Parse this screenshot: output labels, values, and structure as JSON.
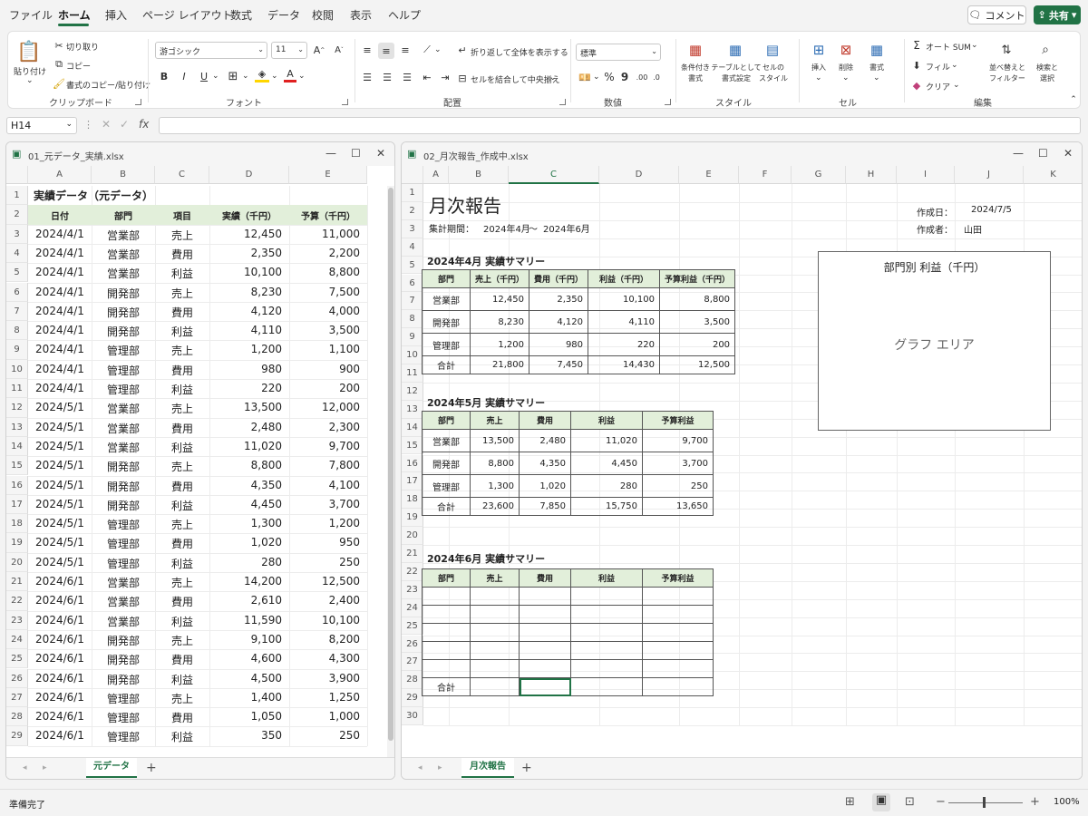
{
  "menu": [
    "ファイル",
    "ホーム",
    "挿入",
    "ページ レイアウト",
    "数式",
    "データ",
    "校閲",
    "表示",
    "ヘルプ"
  ],
  "comment_label": "コメント",
  "share_label": "共有",
  "ribbon": {
    "paste": "貼り付け",
    "cut": "切り取り",
    "copy": "コピー",
    "format_painter": "書式のコピー/貼り付け",
    "clipboard": "クリップボード",
    "font_name": "游ゴシック",
    "font_size": "11",
    "bold": "B",
    "italic": "I",
    "underline": "U",
    "font_group": "フォント",
    "wrap": "折り返して全体を表示する",
    "merge": "セルを結合して中央揃え",
    "align_group": "配置",
    "number_format": "標準",
    "percent": "%",
    "comma": "9",
    "number_group": "数値",
    "cond_format": "条件付き\n書式",
    "table_format": "テーブルとして\n書式設定",
    "cell_style": "セルの\nスタイル",
    "style_group": "スタイル",
    "insert": "挿入",
    "delete": "削除",
    "format": "書式",
    "cells_group": "セル",
    "autosum": "オート SUM",
    "fill": "フィル",
    "clear": "クリア",
    "sort": "並べ替えと\nフィルター",
    "find": "検索と\n選択",
    "edit_group": "編集"
  },
  "namebox": "H14",
  "left": {
    "title": "01_元データ_実績.xlsx",
    "cols": [
      "A",
      "B",
      "C",
      "D",
      "E"
    ],
    "header_row": [
      "日付",
      "部門",
      "項目",
      "実績（千円）",
      "予算（千円）"
    ],
    "a1": "実績データ（元データ）",
    "rows": [
      [
        "2024/4/1",
        "営業部",
        "売上",
        "12,450",
        "11,000"
      ],
      [
        "2024/4/1",
        "営業部",
        "費用",
        "2,350",
        "2,200"
      ],
      [
        "2024/4/1",
        "営業部",
        "利益",
        "10,100",
        "8,800"
      ],
      [
        "2024/4/1",
        "開発部",
        "売上",
        "8,230",
        "7,500"
      ],
      [
        "2024/4/1",
        "開発部",
        "費用",
        "4,120",
        "4,000"
      ],
      [
        "2024/4/1",
        "開発部",
        "利益",
        "4,110",
        "3,500"
      ],
      [
        "2024/4/1",
        "管理部",
        "売上",
        "1,200",
        "1,100"
      ],
      [
        "2024/4/1",
        "管理部",
        "費用",
        "980",
        "900"
      ],
      [
        "2024/4/1",
        "管理部",
        "利益",
        "220",
        "200"
      ],
      [
        "2024/5/1",
        "営業部",
        "売上",
        "13,500",
        "12,000"
      ],
      [
        "2024/5/1",
        "営業部",
        "費用",
        "2,480",
        "2,300"
      ],
      [
        "2024/5/1",
        "営業部",
        "利益",
        "11,020",
        "9,700"
      ],
      [
        "2024/5/1",
        "開発部",
        "売上",
        "8,800",
        "7,800"
      ],
      [
        "2024/5/1",
        "開発部",
        "費用",
        "4,350",
        "4,100"
      ],
      [
        "2024/5/1",
        "開発部",
        "利益",
        "4,450",
        "3,700"
      ],
      [
        "2024/5/1",
        "管理部",
        "売上",
        "1,300",
        "1,200"
      ],
      [
        "2024/5/1",
        "管理部",
        "費用",
        "1,020",
        "950"
      ],
      [
        "2024/5/1",
        "管理部",
        "利益",
        "280",
        "250"
      ],
      [
        "2024/6/1",
        "営業部",
        "売上",
        "14,200",
        "12,500"
      ],
      [
        "2024/6/1",
        "営業部",
        "費用",
        "2,610",
        "2,400"
      ],
      [
        "2024/6/1",
        "営業部",
        "利益",
        "11,590",
        "10,100"
      ],
      [
        "2024/6/1",
        "開発部",
        "売上",
        "9,100",
        "8,200"
      ],
      [
        "2024/6/1",
        "開発部",
        "費用",
        "4,600",
        "4,300"
      ],
      [
        "2024/6/1",
        "開発部",
        "利益",
        "4,500",
        "3,900"
      ],
      [
        "2024/6/1",
        "管理部",
        "売上",
        "1,400",
        "1,250"
      ],
      [
        "2024/6/1",
        "管理部",
        "費用",
        "1,050",
        "1,000"
      ],
      [
        "2024/6/1",
        "管理部",
        "利益",
        "350",
        "250"
      ]
    ],
    "sheet_tab": "元データ"
  },
  "right": {
    "title": "02_月次報告_作成中.xlsx",
    "cols": [
      "A",
      "B",
      "C",
      "D",
      "E",
      "F",
      "G",
      "H",
      "I",
      "J",
      "K"
    ],
    "report_title": "月次報告",
    "period_label": "集計期間：",
    "period_from": "2024年4月",
    "period_sep": "～",
    "period_to": "2024年6月",
    "created_label": "作成日：",
    "created_value": "2024/7/5",
    "author_label": "作成者：",
    "author_value": "山田",
    "chart_title": "部門別 利益（千円）",
    "chart_placeholder": "グラフ エリア",
    "apr_title": "2024年4月 実績サマリー",
    "apr_header": [
      "部門",
      "売上（千円）",
      "費用（千円）",
      "利益（千円）",
      "予算利益（千円）"
    ],
    "apr_rows": [
      [
        "営業部",
        "12,450",
        "2,350",
        "10,100",
        "8,800"
      ],
      [
        "開発部",
        "8,230",
        "4,120",
        "4,110",
        "3,500"
      ],
      [
        "管理部",
        "1,200",
        "980",
        "220",
        "200"
      ],
      [
        "合計",
        "21,800",
        "7,450",
        "14,430",
        "12,500"
      ]
    ],
    "may_title": "2024年5月 実績サマリー",
    "may_header": [
      "部門",
      "売上",
      "費用",
      "利益",
      "予算利益"
    ],
    "may_rows": [
      [
        "営業部",
        "13,500",
        "2,480",
        "11,020",
        "9,700"
      ],
      [
        "開発部",
        "8,800",
        "4,350",
        "4,450",
        "3,700"
      ],
      [
        "管理部",
        "1,300",
        "1,020",
        "280",
        "250"
      ],
      [
        "合計",
        "23,600",
        "7,850",
        "15,750",
        "13,650"
      ]
    ],
    "jun_title": "2024年6月 実績サマリー",
    "jun_header": [
      "部門",
      "売上",
      "費用",
      "利益",
      "予算利益"
    ],
    "jun_total": "合計",
    "sheet_tab": "月次報告"
  },
  "status": {
    "ready": "準備完了",
    "zoom": "100%"
  }
}
